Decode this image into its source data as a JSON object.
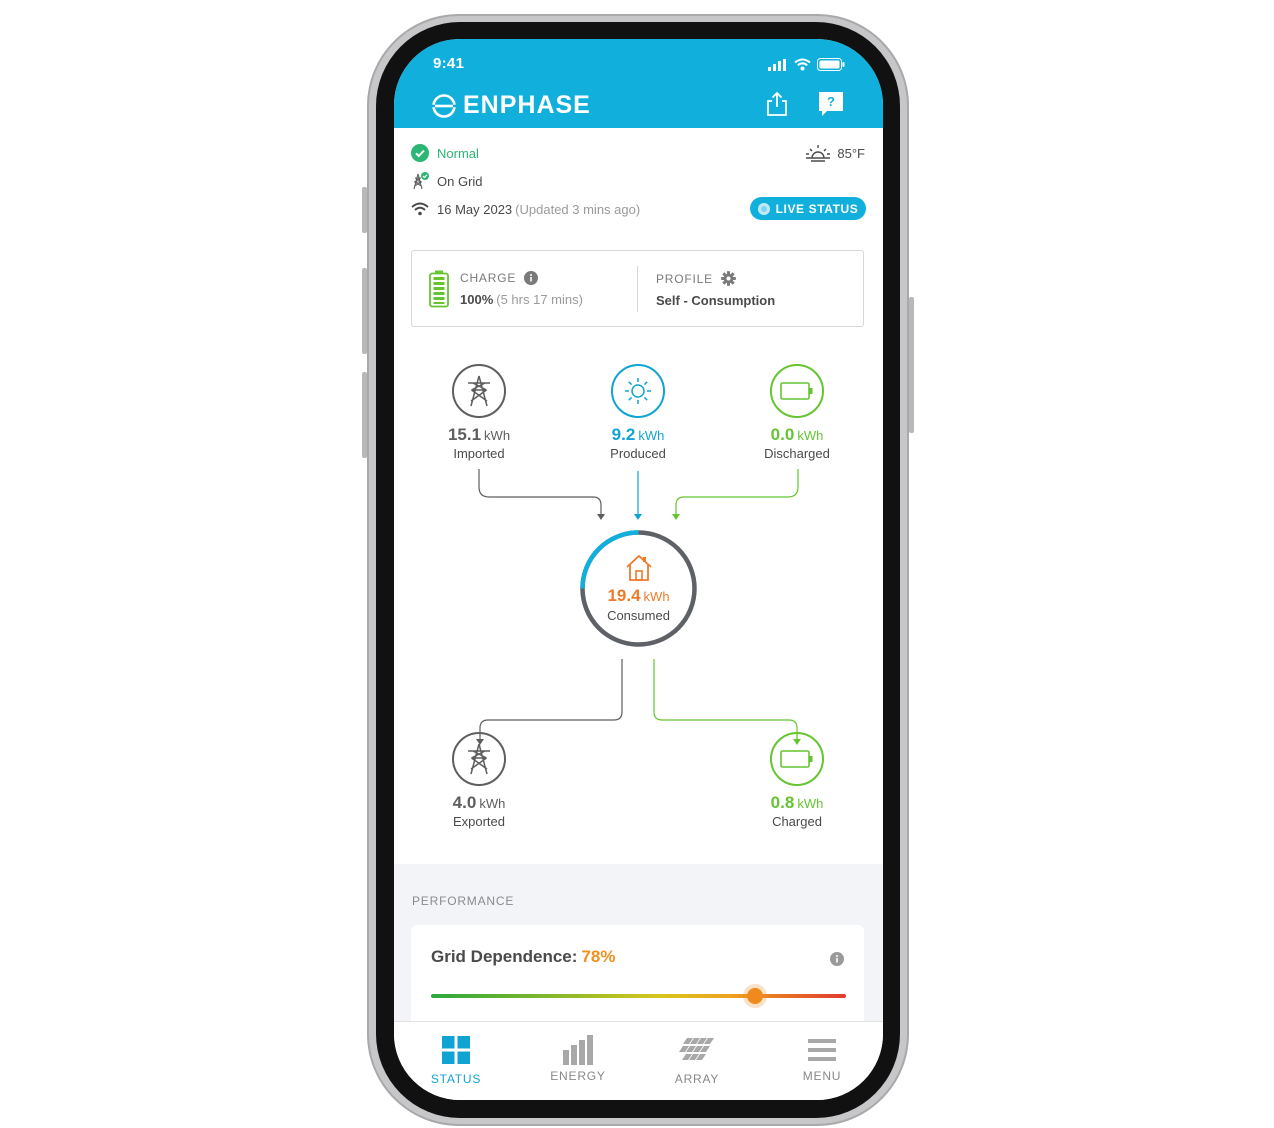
{
  "status_bar": {
    "time": "9:41"
  },
  "header": {
    "logo_text": "ENPHASE"
  },
  "status": {
    "normal": "Normal",
    "grid": "On Grid",
    "date": "16 May 2023",
    "updated": "(Updated 3 mins ago)",
    "temperature": "85°F",
    "live_button": "LIVE STATUS"
  },
  "battery_card": {
    "charge_label": "CHARGE",
    "charge_value": "100%",
    "charge_time": "(5 hrs 17 mins)",
    "profile_label": "PROFILE",
    "profile_value": "Self - Consumption"
  },
  "flow": {
    "imported": {
      "value": "15.1",
      "unit": "kWh",
      "label": "Imported"
    },
    "produced": {
      "value": "9.2",
      "unit": "kWh",
      "label": "Produced"
    },
    "discharged": {
      "value": "0.0",
      "unit": "kWh",
      "label": "Discharged"
    },
    "consumed": {
      "value": "19.4",
      "unit": "kWh",
      "label": "Consumed"
    },
    "exported": {
      "value": "4.0",
      "unit": "kWh",
      "label": "Exported"
    },
    "charged": {
      "value": "0.8",
      "unit": "kWh",
      "label": "Charged"
    }
  },
  "performance": {
    "section_title": "PERFORMANCE",
    "grid_dependence_label": "Grid Dependence:",
    "grid_dependence_value": "78%",
    "grid_dependence_fraction": 0.78
  },
  "tabs": [
    {
      "label": "STATUS",
      "icon": "grid-icon",
      "active": true
    },
    {
      "label": "ENERGY",
      "icon": "bar-chart-icon",
      "active": false
    },
    {
      "label": "ARRAY",
      "icon": "solar-array-icon",
      "active": false
    },
    {
      "label": "MENU",
      "icon": "menu-icon",
      "active": false
    }
  ],
  "colors": {
    "brand": "#11b0dc",
    "normal_green": "#2bb673",
    "battery_green": "#65c430",
    "consumed_orange": "#ef7a2a",
    "grid_grey": "#5e5e5e",
    "accent_orange": "#f0901e"
  }
}
